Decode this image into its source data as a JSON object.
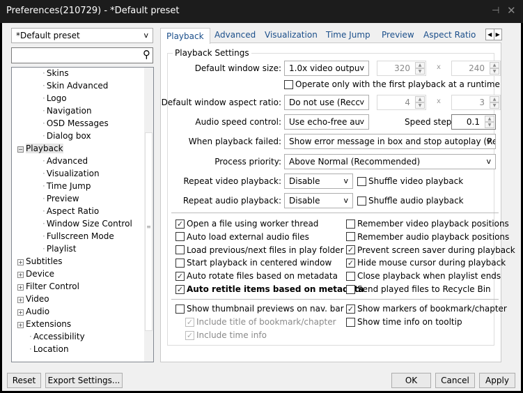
{
  "window": {
    "title": "Preferences(210729) - *Default preset",
    "pin_icon": "pin-icon",
    "close_icon": "close-icon"
  },
  "sidebar": {
    "preset": "*Default preset",
    "search_placeholder": "",
    "search_value": "",
    "tree": [
      {
        "label": "Skins",
        "level": 2
      },
      {
        "label": "Skin Advanced",
        "level": 2
      },
      {
        "label": "Logo",
        "level": 2
      },
      {
        "label": "Navigation",
        "level": 2
      },
      {
        "label": "OSD Messages",
        "level": 2
      },
      {
        "label": "Dialog box",
        "level": 2
      },
      {
        "label": "Playback",
        "level": 1,
        "expander": "minus",
        "selected": true
      },
      {
        "label": "Advanced",
        "level": 2
      },
      {
        "label": "Visualization",
        "level": 2
      },
      {
        "label": "Time Jump",
        "level": 2
      },
      {
        "label": "Preview",
        "level": 2
      },
      {
        "label": "Aspect Ratio",
        "level": 2
      },
      {
        "label": "Window Size Control",
        "level": 2
      },
      {
        "label": "Fullscreen Mode",
        "level": 2
      },
      {
        "label": "Playlist",
        "level": 2
      },
      {
        "label": "Subtitles",
        "level": 1,
        "expander": "plus"
      },
      {
        "label": "Device",
        "level": 1,
        "expander": "plus"
      },
      {
        "label": "Filter Control",
        "level": 1,
        "expander": "plus"
      },
      {
        "label": "Video",
        "level": 1,
        "expander": "plus"
      },
      {
        "label": "Audio",
        "level": 1,
        "expander": "plus"
      },
      {
        "label": "Extensions",
        "level": 1,
        "expander": "plus"
      },
      {
        "label": "Accessibility",
        "level": 1
      },
      {
        "label": "Location",
        "level": 1
      }
    ]
  },
  "tabs": [
    {
      "label": "Playback",
      "active": true
    },
    {
      "label": "Advanced"
    },
    {
      "label": "Visualization"
    },
    {
      "label": "Time Jump"
    },
    {
      "label": "Preview"
    },
    {
      "label": "Aspect Ratio"
    }
  ],
  "group": {
    "title": "Playback Settings",
    "default_window_size": {
      "label": "Default window size:",
      "value": "1.0x video outpu",
      "width": "320",
      "height": "240"
    },
    "operate_first": {
      "label": "Operate only with the first playback at a runtime",
      "checked": false
    },
    "aspect_ratio": {
      "label": "Default window aspect ratio:",
      "value": "Do not use (Recc",
      "w": "4",
      "h": "3"
    },
    "audio_speed": {
      "label": "Audio speed control:",
      "value": "Use echo-free au",
      "step_label": "Speed step:",
      "step": "0.1"
    },
    "failed": {
      "label": "When playback failed:",
      "value": "Show error message in box and stop autoplay (Rec"
    },
    "priority": {
      "label": "Process priority:",
      "value": "Above Normal (Recommended)"
    },
    "repeat_video": {
      "label": "Repeat video playback:",
      "value": "Disable",
      "shuffle": "Shuffle video playback"
    },
    "repeat_audio": {
      "label": "Repeat audio playback:",
      "value": "Disable",
      "shuffle": "Shuffle audio playback"
    },
    "times": "x"
  },
  "options_left": [
    {
      "label": "Open a file using worker thread",
      "checked": true
    },
    {
      "label": "Auto load external audio files",
      "checked": false
    },
    {
      "label": "Load previous/next files in play folder",
      "checked": false
    },
    {
      "label": "Start playback in centered window",
      "checked": false
    },
    {
      "label": "Auto rotate files based on metadata",
      "checked": true
    },
    {
      "label": "Auto retitle items based on metadata",
      "checked": true,
      "bold": true
    }
  ],
  "options_right": [
    {
      "label": "Remember video playback positions",
      "checked": false
    },
    {
      "label": "Remember audio playback positions",
      "checked": false
    },
    {
      "label": "Prevent screen saver during playback",
      "checked": true
    },
    {
      "label": "Hide mouse cursor during playback",
      "checked": true
    },
    {
      "label": "Close playback when playlist ends",
      "checked": false
    },
    {
      "label": "Send played files to Recycle Bin",
      "checked": false
    }
  ],
  "thumb_left": [
    {
      "label": "Show thumbnail previews on nav. bar",
      "checked": false
    },
    {
      "label": "Include title of bookmark/chapter",
      "checked": true,
      "disabled": true
    },
    {
      "label": "Include time info",
      "checked": true,
      "disabled": true
    }
  ],
  "thumb_right": [
    {
      "label": "Show markers of bookmark/chapter",
      "checked": true
    },
    {
      "label": "Show time info on tooltip",
      "checked": false
    }
  ],
  "footer": {
    "reset": "Reset",
    "export": "Export Settings...",
    "ok": "OK",
    "cancel": "Cancel",
    "apply": "Apply"
  }
}
